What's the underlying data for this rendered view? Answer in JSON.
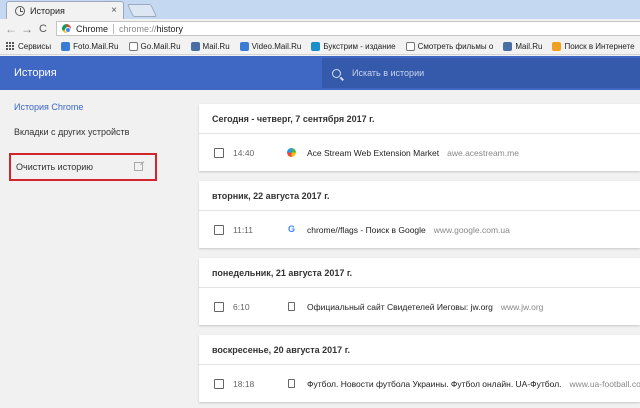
{
  "browser": {
    "tab_title": "История",
    "tab_close": "×",
    "nav": {
      "back": "←",
      "forward": "→",
      "reload": "C"
    },
    "omnibox": {
      "label": "Chrome",
      "url_scheme": "chrome://",
      "url_path": "history"
    }
  },
  "bookmarks": [
    {
      "label": "Сервисы",
      "icon": "apps-icon"
    },
    {
      "label": "Foto.Mail.Ru",
      "icon": "mailru-photo-icon",
      "color": "#3a7bd5"
    },
    {
      "label": "Go.Mail.Ru",
      "icon": "document-icon",
      "color": "#ffffff"
    },
    {
      "label": "Mail.Ru",
      "icon": "mailru-icon",
      "color": "#4a6fa5"
    },
    {
      "label": "Video.Mail.Ru",
      "icon": "mailru-video-icon",
      "color": "#3a7bd5"
    },
    {
      "label": "Букстрим - издание",
      "icon": "bookstream-icon",
      "color": "#1a8fc9"
    },
    {
      "label": "Смотреть фильмы о",
      "icon": "film-icon",
      "color": "#ffffff"
    },
    {
      "label": "Mail.Ru",
      "icon": "mailru-icon",
      "color": "#4a6fa5"
    },
    {
      "label": "Поиск в Интернете",
      "icon": "search-bookmark-icon",
      "color": "#f0a020"
    }
  ],
  "header": {
    "title": "История",
    "search_placeholder": "Искать в истории",
    "accent": "#3f67c4"
  },
  "sidebar": {
    "items": [
      {
        "label": "История Chrome",
        "active": true
      },
      {
        "label": "Вкладки с других устройств",
        "active": false
      }
    ],
    "clear_history": "Очистить историю",
    "highlight_color": "#d3232b"
  },
  "history": [
    {
      "date": "Сегодня - четверг, 7 сентября 2017 г.",
      "entries": [
        {
          "time": "14:40",
          "title": "Ace Stream Web Extension Market",
          "domain": "awe.acestream.me",
          "icon": "acestream-icon"
        }
      ]
    },
    {
      "date": "вторник, 22 августа 2017 г.",
      "entries": [
        {
          "time": "11:11",
          "title": "chrome//flags - Поиск в Google",
          "domain": "www.google.com.ua",
          "icon": "google-icon"
        }
      ]
    },
    {
      "date": "понедельник, 21 августа 2017 г.",
      "entries": [
        {
          "time": "6:10",
          "title": "Официальный сайт Свидетелей Иеговы: jw.org",
          "domain": "www.jw.org",
          "icon": "page-icon"
        }
      ]
    },
    {
      "date": "воскресенье, 20 августа 2017 г.",
      "entries": [
        {
          "time": "18:18",
          "title": "Футбол. Новости футбола Украины. Футбол онлайн. UA-Футбол.",
          "domain": "www.ua-football.com",
          "icon": "page-icon"
        }
      ]
    }
  ]
}
